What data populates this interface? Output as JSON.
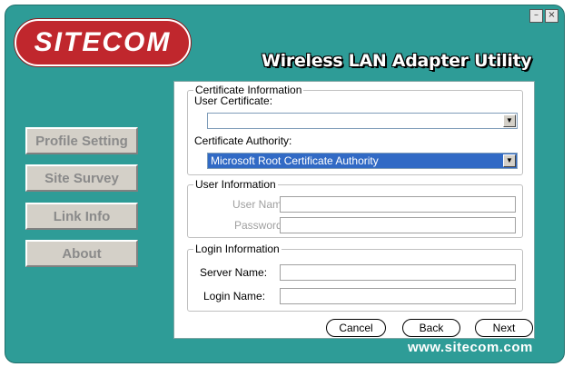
{
  "brand": {
    "logo_text": "SITECOM",
    "url": "www.sitecom.com"
  },
  "window": {
    "title": "Wireless LAN Adapter Utility",
    "minimize_glyph": "–",
    "close_glyph": "×"
  },
  "sidebar": {
    "items": [
      {
        "label": "Profile Setting"
      },
      {
        "label": "Site Survey"
      },
      {
        "label": "Link Info"
      },
      {
        "label": "About"
      }
    ]
  },
  "certificate": {
    "legend": "Certificate Information",
    "user_cert_label": "User Certificate:",
    "user_cert_value": "",
    "ca_label": "Certificate Authority:",
    "ca_value": "Microsoft Root Certificate Authority"
  },
  "user_info": {
    "legend": "User Information",
    "username_label": "User Name:",
    "username_value": "",
    "password_label": "Password:",
    "password_value": ""
  },
  "login_info": {
    "legend": "Login Information",
    "server_label": "Server Name:",
    "server_value": "",
    "login_label": "Login Name:",
    "login_value": ""
  },
  "buttons": {
    "cancel": "Cancel",
    "back": "Back",
    "next": "Next"
  },
  "icons": {
    "dropdown": "chevron-down-icon",
    "minimize": "minimize-icon",
    "close": "close-icon"
  },
  "colors": {
    "background": "#2e9c97",
    "logo": "#c0272d",
    "selection": "#316ac5"
  }
}
